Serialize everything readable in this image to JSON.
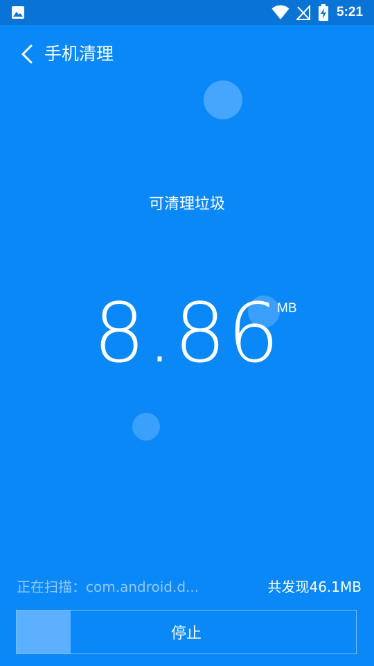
{
  "status_bar": {
    "time": "5:21",
    "icons": [
      "gallery-icon",
      "wifi-icon",
      "no-signal-icon",
      "battery-charging-icon"
    ]
  },
  "header": {
    "back_icon": "chevron-left-icon",
    "title": "手机清理"
  },
  "main": {
    "label": "可清理垃圾",
    "value": "8.86",
    "unit": "MB"
  },
  "footer": {
    "scan_status": "正在扫描：com.android.d...",
    "found_total": "共发现46.1MB",
    "stop_label": "停止",
    "progress_fraction": 0.16
  },
  "colors": {
    "background": "#0a88f8",
    "status_bar": "#0a73d6",
    "accent_light": "#78beff",
    "text": "#ffffff"
  }
}
